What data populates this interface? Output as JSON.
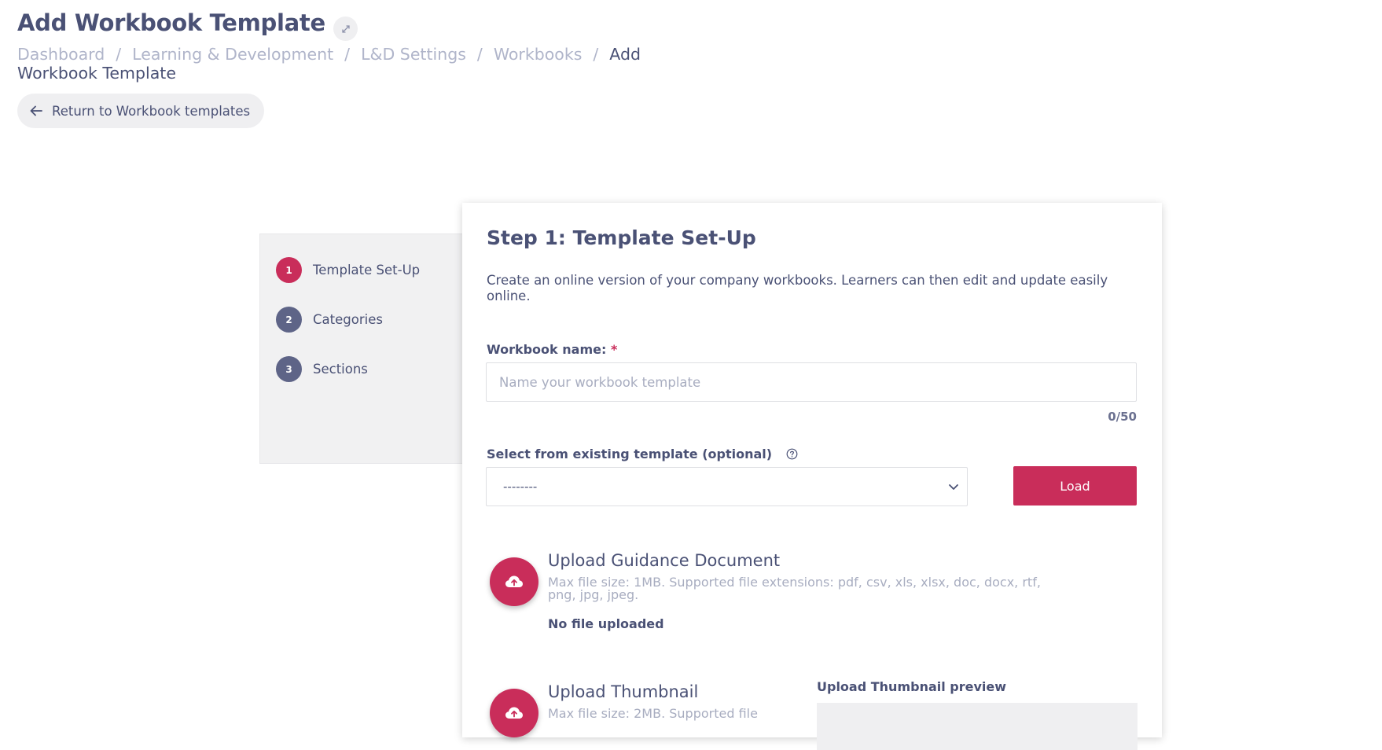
{
  "page": {
    "title": "Add Workbook Template",
    "breadcrumb": [
      "Dashboard",
      "Learning & Development",
      "L&D Settings",
      "Workbooks",
      "Add Workbook Template"
    ],
    "breadcrumb_separator": "/",
    "return_label": "Return to Workbook templates"
  },
  "steps": [
    {
      "number": "1",
      "label": "Template Set-Up",
      "active": true
    },
    {
      "number": "2",
      "label": "Categories",
      "active": false
    },
    {
      "number": "3",
      "label": "Sections",
      "active": false
    }
  ],
  "form": {
    "title": "Step 1: Template Set-Up",
    "description": "Create an online version of your company workbooks. Learners can then edit and update easily online.",
    "name_label": "Workbook name:",
    "required_marker": "*",
    "name_placeholder": "Name your workbook template",
    "name_value": "",
    "char_count": "0/50",
    "template_label": "Select from existing template (optional)",
    "template_selected": "--------",
    "load_label": "Load",
    "guidance": {
      "title": "Upload Guidance Document",
      "info": "Max file size: 1MB. Supported file extensions: pdf, csv, xls, xlsx, doc, docx, rtf, png, jpg, jpeg.",
      "status": "No file uploaded"
    },
    "thumbnail": {
      "title": "Upload Thumbnail",
      "info": "Max file size: 2MB. Supported file",
      "preview_label": "Upload Thumbnail preview"
    }
  },
  "colors": {
    "accent": "#c92d5a",
    "step_inactive": "#5e6487",
    "text": "#4a5175",
    "muted": "#b0b5ca"
  },
  "icons": {
    "expand": "expand-icon",
    "back": "arrow-left-icon",
    "help": "question-circle-icon",
    "chevron": "chevron-down-icon",
    "upload": "cloud-upload-icon"
  }
}
